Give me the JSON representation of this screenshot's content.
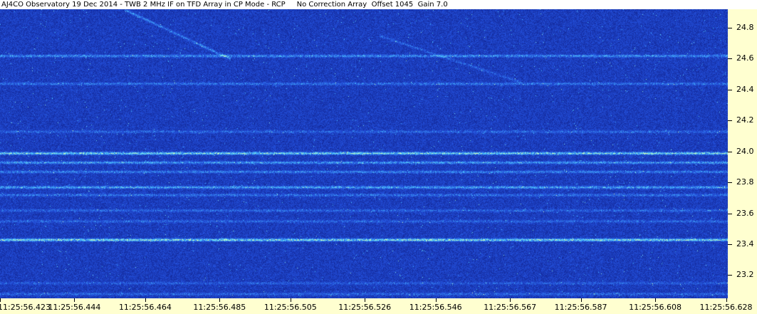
{
  "title": "AJ4CO Observatory 19 Dec 2014 - TWB 2 MHz IF on TFD Array in CP Mode - RCP     No Correction Array  Offset 1045  Gain 7.0",
  "colors": {
    "background": "#ffffd0",
    "plot_base": "#1a2fb0",
    "plot_bright": "#7fd0ff",
    "title_bg": "#ffffff"
  },
  "chart_data": {
    "type": "heatmap",
    "subtype": "dynamic-spectrogram",
    "title": "AJ4CO Observatory 19 Dec 2014 - TWB 2 MHz IF on TFD Array in CP Mode - RCP     No Correction Array  Offset 1045  Gain 7.0",
    "xlabel": "",
    "ylabel": "",
    "x_tick_labels": [
      "11:25:56.423",
      "11:25:56.444",
      "11:25:56.464",
      "11:25:56.485",
      "11:25:56.505",
      "11:25:56.526",
      "11:25:56.546",
      "11:25:56.567",
      "11:25:56.587",
      "11:25:56.608",
      "11:25:56.628"
    ],
    "x_ticks_ms": [
      423,
      444,
      464,
      485,
      505,
      526,
      546,
      567,
      587,
      608,
      628
    ],
    "x_range_ms": [
      423,
      628.5
    ],
    "y_tick_labels": [
      "24.8",
      "24.6",
      "24.4",
      "24.2",
      "24.0",
      "23.8",
      "23.6",
      "23.4",
      "23.2"
    ],
    "y_ticks": [
      24.8,
      24.6,
      24.4,
      24.2,
      24.0,
      23.8,
      23.6,
      23.4,
      23.2
    ],
    "y_range": [
      23.05,
      24.92
    ],
    "y_unit": "MHz",
    "axis_side": "right",
    "grid": false,
    "legend": "none",
    "emissions": [
      {
        "kind": "band",
        "freq": 24.62,
        "intensity": 0.45
      },
      {
        "kind": "band",
        "freq": 24.44,
        "intensity": 0.35
      },
      {
        "kind": "band",
        "freq": 24.13,
        "intensity": 0.3
      },
      {
        "kind": "band",
        "freq": 23.99,
        "intensity": 0.75
      },
      {
        "kind": "band",
        "freq": 23.93,
        "intensity": 0.5
      },
      {
        "kind": "band",
        "freq": 23.87,
        "intensity": 0.4
      },
      {
        "kind": "band",
        "freq": 23.77,
        "intensity": 0.55
      },
      {
        "kind": "band",
        "freq": 23.72,
        "intensity": 0.35
      },
      {
        "kind": "band",
        "freq": 23.62,
        "intensity": 0.3
      },
      {
        "kind": "band",
        "freq": 23.55,
        "intensity": 0.3
      },
      {
        "kind": "band",
        "freq": 23.43,
        "intensity": 0.8
      },
      {
        "kind": "band",
        "freq": 23.15,
        "intensity": 0.25
      },
      {
        "kind": "band",
        "freq": 23.08,
        "intensity": 0.3
      },
      {
        "kind": "drift",
        "t_start_ms": 458,
        "t_end_ms": 488,
        "f_start": 24.92,
        "f_end": 24.6,
        "intensity": 0.4
      },
      {
        "kind": "drift",
        "t_start_ms": 530,
        "t_end_ms": 570,
        "f_start": 24.75,
        "f_end": 24.45,
        "intensity": 0.25
      }
    ]
  }
}
